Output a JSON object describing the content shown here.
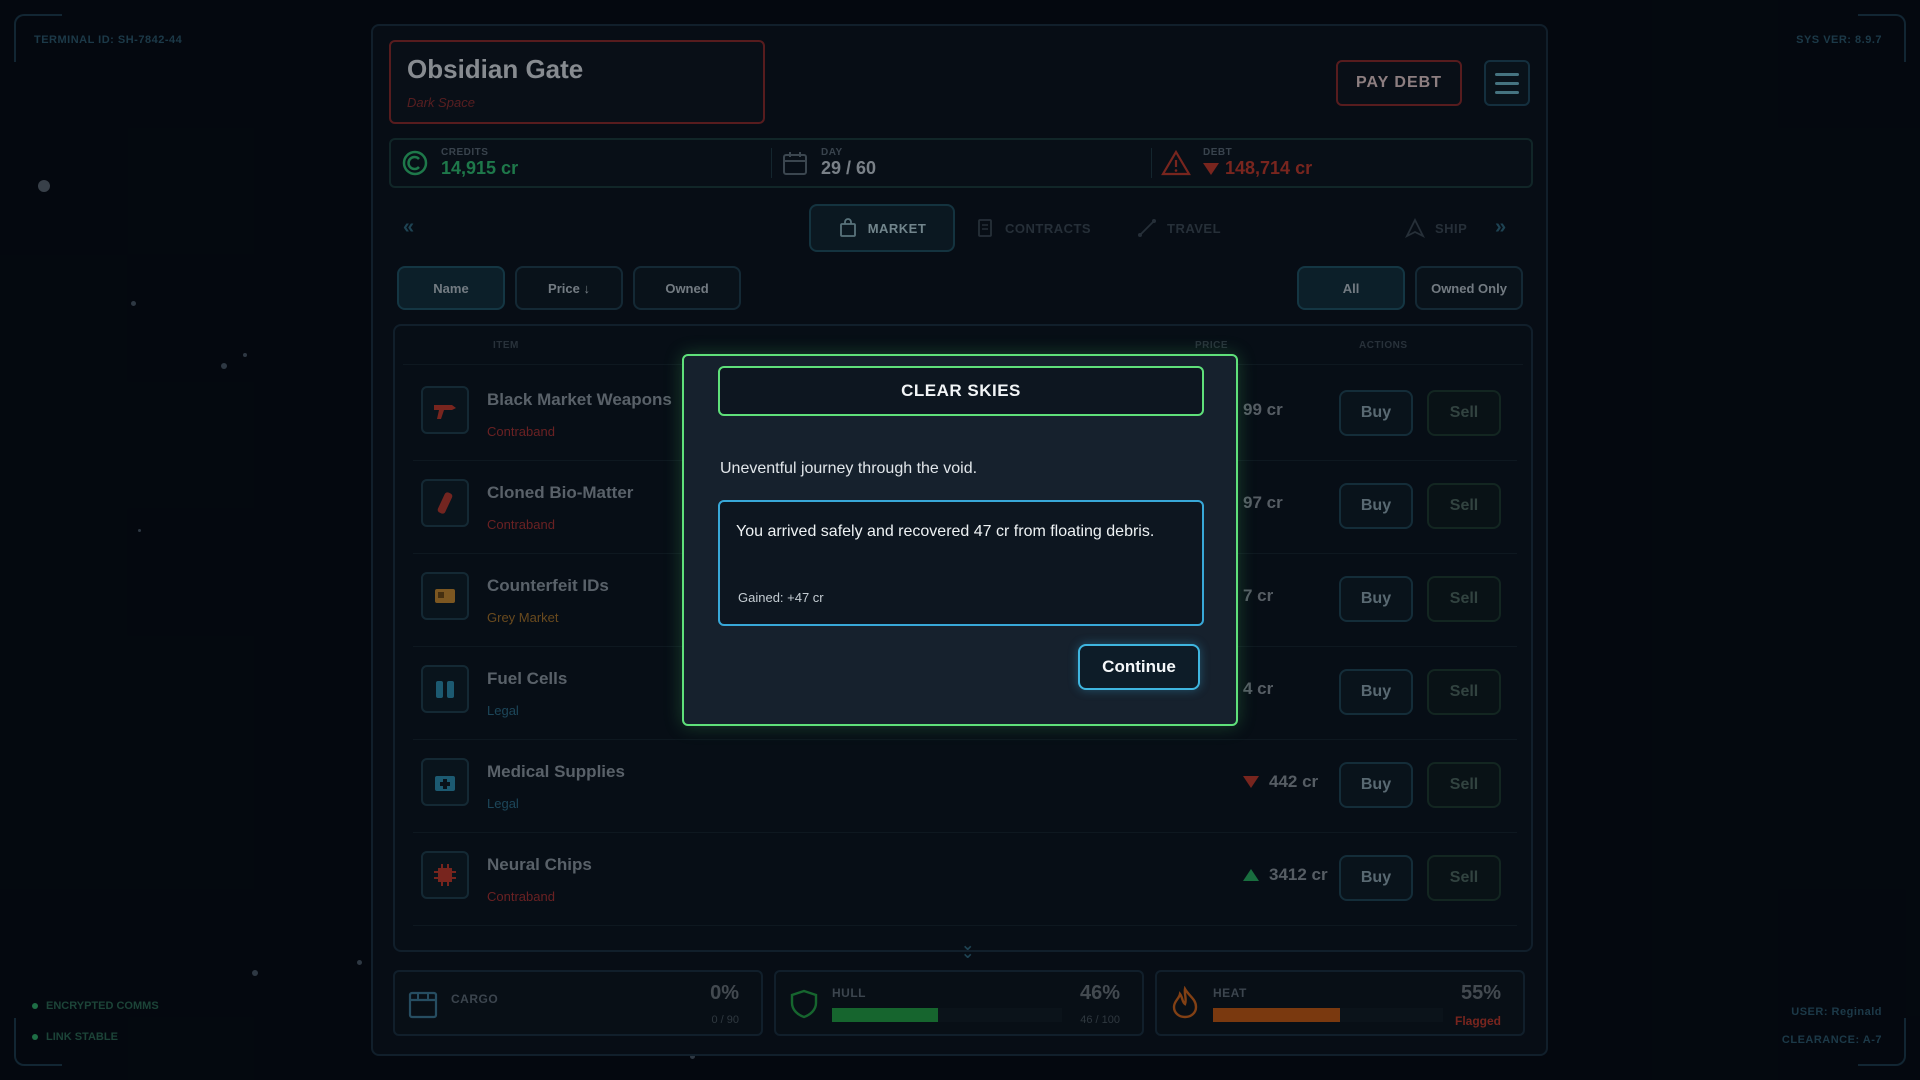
{
  "system": {
    "terminal_id": "TERMINAL ID: SH-7842-44",
    "sys_ver": "SYS VER: 8.9.7",
    "status_comms": "ENCRYPTED COMMS",
    "status_link": "LINK STABLE",
    "user": "USER: Reginald",
    "clearance": "CLEARANCE: A-7"
  },
  "location": {
    "name": "Obsidian Gate",
    "region": "Dark Space"
  },
  "header": {
    "pay_debt_label": "PAY DEBT",
    "menu_icon": "hamburger-menu-icon"
  },
  "stats": {
    "credits_label": "CREDITS",
    "credits_value": "14,915 cr",
    "day_label": "DAY",
    "day_value": "29 / 60",
    "debt_label": "DEBT",
    "debt_value": "148,714 cr",
    "colors": {
      "credits": "#2fbf71",
      "debt": "#c0392b"
    }
  },
  "tabs": [
    {
      "label": "MARKET",
      "icon": "shopping-bag-icon",
      "active": true
    },
    {
      "label": "CONTRACTS",
      "icon": "document-icon",
      "active": false
    },
    {
      "label": "TRAVEL",
      "icon": "route-icon",
      "active": false
    },
    {
      "label": "SHIP",
      "icon": "ship-icon",
      "active": false
    }
  ],
  "sort": {
    "name": "Name",
    "price": "Price ↓",
    "owned": "Owned"
  },
  "filter": {
    "all": "All",
    "owned_only": "Owned Only"
  },
  "table": {
    "headers": {
      "item": "ITEM",
      "price": "PRICE",
      "actions": "ACTIONS"
    },
    "buy_label": "Buy",
    "sell_label": "Sell",
    "rows": [
      {
        "name": "Black Market Weapons",
        "category": "Contraband",
        "price": "99 cr",
        "trend": "none",
        "icon": "blaster-icon"
      },
      {
        "name": "Cloned Bio-Matter",
        "category": "Contraband",
        "price": "97 cr",
        "trend": "none",
        "icon": "vial-icon"
      },
      {
        "name": "Counterfeit IDs",
        "category": "Grey Market",
        "price": "7 cr",
        "trend": "none",
        "icon": "id-card-icon"
      },
      {
        "name": "Fuel Cells",
        "category": "Legal",
        "price": "4 cr",
        "trend": "none",
        "icon": "fuel-cell-icon"
      },
      {
        "name": "Medical Supplies",
        "category": "Legal",
        "price": "442 cr",
        "trend": "down",
        "icon": "medkit-icon"
      },
      {
        "name": "Neural Chips",
        "category": "Contraband",
        "price": "3412 cr",
        "trend": "up",
        "icon": "chip-icon"
      }
    ],
    "category_colors": {
      "Contraband": "#a83232",
      "Grey Market": "#a8742a",
      "Legal": "#2c6e8a"
    }
  },
  "footer": {
    "cargo": {
      "label": "CARGO",
      "pct": "0%",
      "sub": "0 / 90",
      "fill": 0
    },
    "hull": {
      "label": "HULL",
      "pct": "46%",
      "sub": "46 / 100",
      "fill": 0.46,
      "color": "#23a045"
    },
    "heat": {
      "label": "HEAT",
      "pct": "55%",
      "sub": "Flagged",
      "fill": 0.55,
      "color": "#c45a12"
    }
  },
  "modal": {
    "title": "CLEAR SKIES",
    "description": "Uneventful journey through the void.",
    "result": "You arrived safely and recovered 47 cr from floating debris.",
    "gained": "Gained: +47 cr",
    "continue_label": "Continue"
  }
}
